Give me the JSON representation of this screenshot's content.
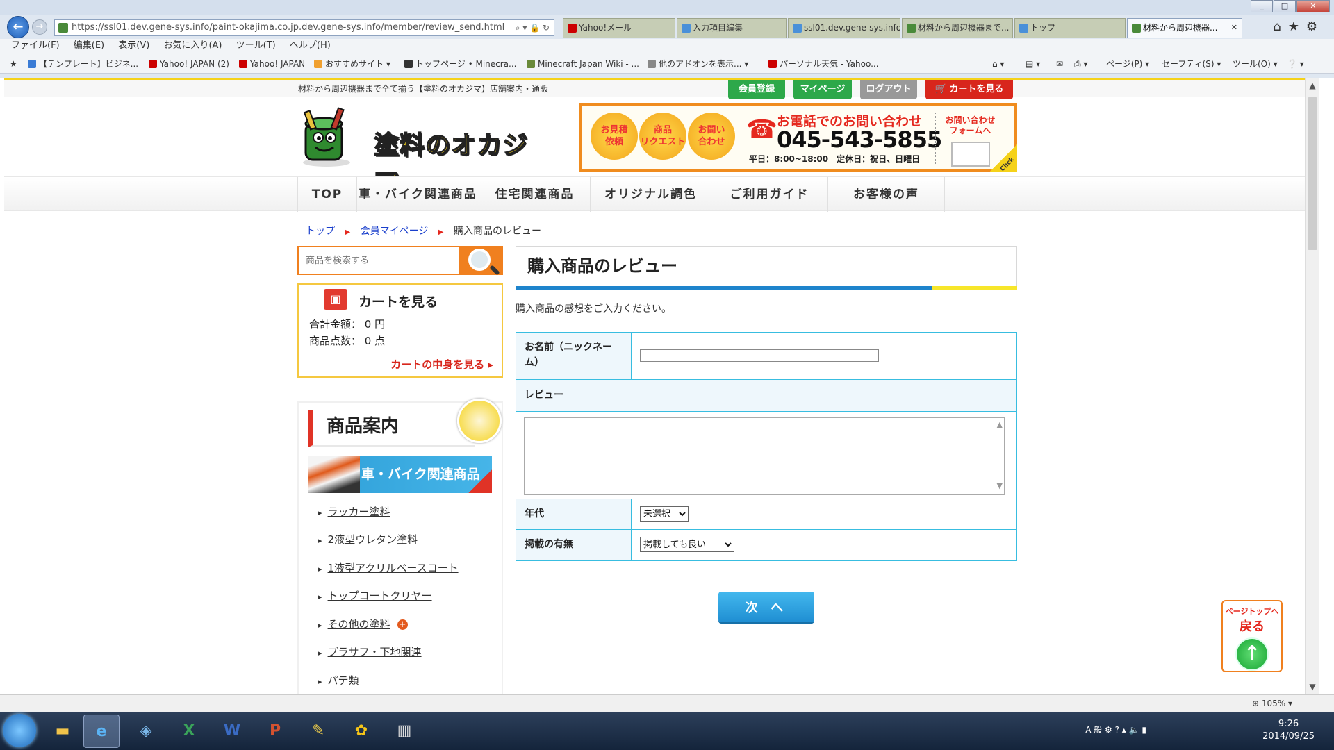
{
  "browser": {
    "address_url": "https://ssl01.dev.gene-sys.info/paint-okajima.co.jp.dev.gene-sys.info/member/review_send.html",
    "tabs": [
      {
        "label": "Yahoo!メール"
      },
      {
        "label": "入力項目編集"
      },
      {
        "label": "ssl01.dev.gene-sys.info"
      },
      {
        "label": "材料から周辺機器まで..."
      },
      {
        "label": "トップ"
      },
      {
        "label": "材料から周辺機器..."
      }
    ],
    "menu": [
      "ファイル(F)",
      "編集(E)",
      "表示(V)",
      "お気に入り(A)",
      "ツール(T)",
      "ヘルプ(H)"
    ],
    "favorites": [
      "【テンプレート】ビジネ...",
      "Yahoo! JAPAN (2)",
      "Yahoo! JAPAN",
      "おすすめサイト ▾",
      "トップページ • Minecra...",
      "Minecraft Japan Wiki - ...",
      "他のアドオンを表示...",
      "パーソナル天気 - Yahoo..."
    ],
    "commands": [
      "ページ(P) ▾",
      "セーフティ(S) ▾",
      "ツール(O) ▾"
    ],
    "zoom": "105%",
    "clock_time": "9:26",
    "clock_date": "2014/09/25"
  },
  "site": {
    "tagline": "材料から周辺機器まで全て揃う【塗料のオカジマ】店舗案内・通販",
    "top_buttons": {
      "register": "会員登録",
      "mypage": "マイページ",
      "logout": "ログアウト",
      "cart": "カートを見る"
    },
    "logo_text": "塗料のオカジマ",
    "contact": {
      "circle1": "お見積\n依頼",
      "circle2": "商品\nリクエスト",
      "circle3": "お問い\n合わせ",
      "phone_title": "お電話でのお問い合わせ",
      "phone_number": "045-543-5855",
      "hours": "平日：8:00~18:00　定休日：祝日、日曜日",
      "form_link": "お問い合わせ\nフォームへ",
      "click": "Click"
    },
    "gnav": [
      "TOP",
      "車・バイク関連商品",
      "住宅関連商品",
      "オリジナル調色",
      "ご利用ガイド",
      "お客様の声"
    ],
    "breadcrumb": {
      "home": "トップ",
      "mypage": "会員マイページ",
      "current": "購入商品のレビュー"
    },
    "sidebar": {
      "search_placeholder": "商品を検索する",
      "cart_title": "カートを見る",
      "cart_total": "合計金額：  0 円",
      "cart_count": "商品点数：  0 点",
      "cart_link": "カートの中身を見る",
      "product_heading": "商品案内",
      "car_banner": "車・バイク関連商品",
      "categories": [
        "ラッカー塗料",
        "2液型ウレタン塗料",
        "1液型アクリルベースコート",
        "トップコートクリヤー",
        "その他の塗料",
        "プラサフ・下地関連",
        "パテ類"
      ]
    },
    "main": {
      "heading": "購入商品のレビュー",
      "intro": "購入商品の感想をご入力ください。",
      "name_label": "お名前（ニックネーム）",
      "name_value": "",
      "review_label": "レビュー",
      "review_value": "",
      "age_label": "年代",
      "age_selected": "未選択",
      "publish_label": "掲載の有無",
      "publish_selected": "掲載しても良い",
      "next_button": "次 へ"
    },
    "page_top": {
      "small": "ページトップへ",
      "big": "戻る"
    }
  }
}
